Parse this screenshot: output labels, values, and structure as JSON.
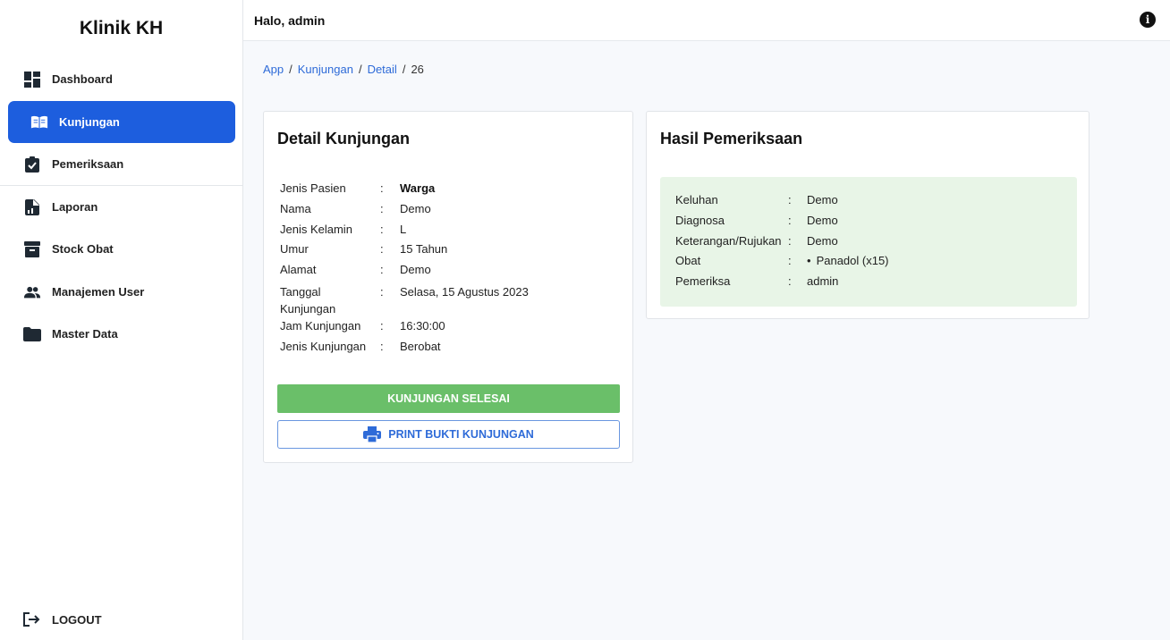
{
  "sidebar": {
    "brand": "Klinik KH",
    "items": [
      {
        "label": "Dashboard",
        "icon": "dashboard-icon"
      },
      {
        "label": "Kunjungan",
        "icon": "book-icon",
        "active": true
      },
      {
        "label": "Pemeriksaan",
        "icon": "clipboard-check-icon"
      },
      {
        "label": "Laporan",
        "icon": "report-icon"
      },
      {
        "label": "Stock Obat",
        "icon": "archive-icon"
      },
      {
        "label": "Manajemen User",
        "icon": "users-icon"
      },
      {
        "label": "Master Data",
        "icon": "folder-icon"
      }
    ],
    "logout": "LOGOUT"
  },
  "header": {
    "greeting": "Halo, admin",
    "info_icon": "info-icon"
  },
  "breadcrumb": {
    "items": [
      "App",
      "Kunjungan",
      "Detail"
    ],
    "current": "26",
    "separator": "/"
  },
  "detail": {
    "title": "Detail Kunjungan",
    "fields": [
      {
        "label": "Jenis Pasien",
        "value": "Warga"
      },
      {
        "label": "Nama",
        "value": "Demo"
      },
      {
        "label": "Jenis Kelamin",
        "value": "L"
      },
      {
        "label": "Umur",
        "value": "15 Tahun"
      },
      {
        "label": "Alamat",
        "value": "Demo"
      },
      {
        "label": "Tanggal Kunjungan",
        "value": "Selasa, 15 Agustus 2023"
      },
      {
        "label": "Jam Kunjungan",
        "value": "16:30:00"
      },
      {
        "label": "Jenis Kunjungan",
        "value": "Berobat"
      }
    ],
    "colon": ":",
    "btn_selesai": "KUNJUNGAN SELESAI",
    "btn_print": "PRINT BUKTI KUNJUNGAN"
  },
  "hasil": {
    "title": "Hasil Pemeriksaan",
    "fields": [
      {
        "label": "Keluhan",
        "value": "Demo"
      },
      {
        "label": "Diagnosa",
        "value": "Demo"
      },
      {
        "label": "Keterangan/Rujukan",
        "value": "Demo"
      },
      {
        "label": "Obat",
        "value": "Panadol (x15)"
      },
      {
        "label": "Pemeriksa",
        "value": "admin"
      }
    ],
    "bullet": "•"
  },
  "colors": {
    "primary": "#1d5ede",
    "success": "#6abf69",
    "hasil_bg": "#e8f5e7",
    "link": "#2e6bd8"
  }
}
